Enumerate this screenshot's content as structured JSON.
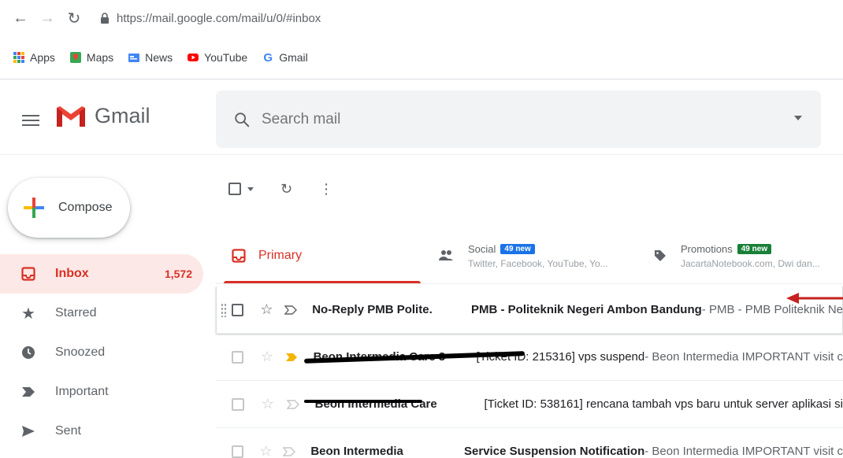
{
  "browser": {
    "url": "https://mail.google.com/mail/u/0/#inbox",
    "bookmarks": [
      {
        "label": "Apps",
        "icon": "apps-grid-icon"
      },
      {
        "label": "Maps",
        "icon": "maps-icon"
      },
      {
        "label": "News",
        "icon": "news-icon"
      },
      {
        "label": "YouTube",
        "icon": "youtube-icon"
      },
      {
        "label": "Gmail",
        "icon": "google-g-icon"
      }
    ]
  },
  "header": {
    "logo_text": "Gmail",
    "search_placeholder": "Search mail"
  },
  "sidebar": {
    "compose_label": "Compose",
    "items": [
      {
        "label": "Inbox",
        "count": "1,572",
        "icon": "inbox-icon",
        "active": true
      },
      {
        "label": "Starred",
        "count": "",
        "icon": "star-icon"
      },
      {
        "label": "Snoozed",
        "count": "",
        "icon": "clock-icon"
      },
      {
        "label": "Important",
        "count": "",
        "icon": "important-icon"
      },
      {
        "label": "Sent",
        "count": "",
        "icon": "send-icon"
      }
    ]
  },
  "tabs": {
    "primary": {
      "label": "Primary"
    },
    "social": {
      "label": "Social",
      "badge": "49 new",
      "sub": "Twitter, Facebook, YouTube, Yo..."
    },
    "promotions": {
      "label": "Promotions",
      "badge": "49 new",
      "sub": "JacartaNotebook.com, Dwi dan..."
    }
  },
  "messages": [
    {
      "sender": "No-Reply PMB Polite.",
      "subject": "PMB - Politeknik Negeri Ambon Bandung",
      "snippet": " - PMB - PMB Politeknik Ne"
    },
    {
      "sender": "Beon Intermedia Care 3",
      "subject": "[Ticket ID: 215316] vps suspend",
      "snippet": " - Beon Intermedia IMPORTANT visit c"
    },
    {
      "sender": "Beon Intermedia Care",
      "subject": "[Ticket ID: 538161] rencana tambah vps baru untuk server aplikasi si",
      "snippet": ""
    },
    {
      "sender": "Beon Intermedia",
      "subject": "Service Suspension Notification",
      "snippet": " - Beon Intermedia IMPORTANT visit c"
    }
  ],
  "colors": {
    "accent_red": "#d93025",
    "social_badge": "#1a73e8",
    "promo_badge": "#188038",
    "important_marker": "#f4b400",
    "arrow": "#c5221f"
  }
}
